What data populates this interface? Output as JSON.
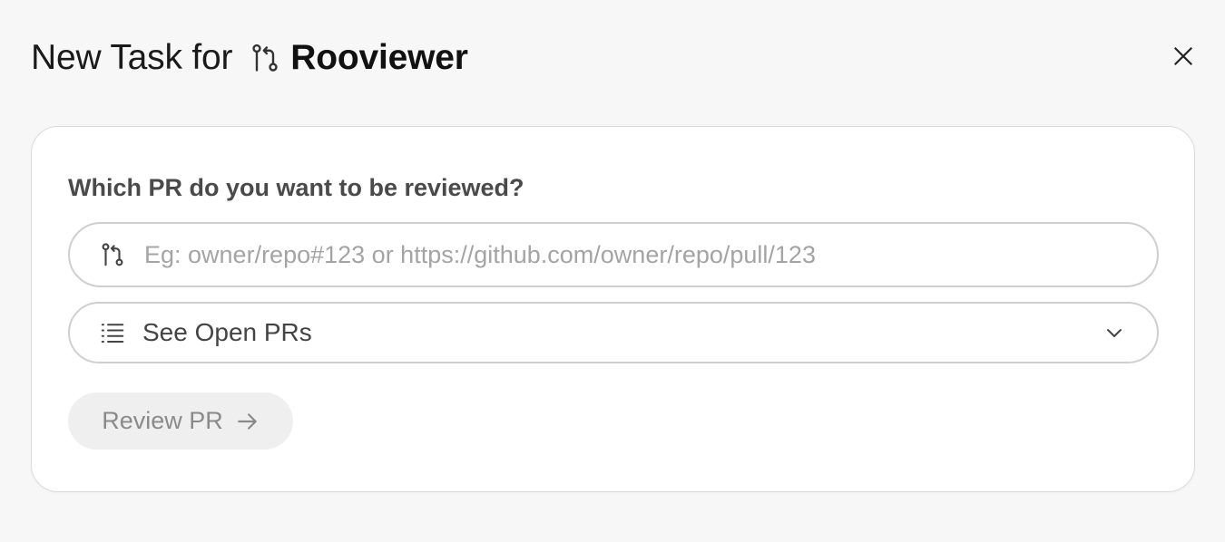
{
  "dialog": {
    "title_prefix": "New Task for",
    "agent_name": "Rooviewer",
    "agent_icon": "git-pull-request-icon",
    "close_icon": "close-icon"
  },
  "form": {
    "question": "Which PR do you want to be reviewed?",
    "pr_input": {
      "icon": "git-pull-request-icon",
      "value": "",
      "placeholder": "Eg: owner/repo#123 or https://github.com/owner/repo/pull/123"
    },
    "open_prs_select": {
      "icon": "list-icon",
      "label": "See Open PRs",
      "chevron": "chevron-down-icon"
    },
    "submit": {
      "label": "Review PR",
      "icon": "arrow-right-icon",
      "disabled": true
    }
  },
  "colors": {
    "background": "#f7f7f7",
    "card": "#ffffff",
    "border": "#cfcfcf",
    "disabled_button_bg": "#efefef",
    "disabled_button_text": "#8a8a8a"
  }
}
